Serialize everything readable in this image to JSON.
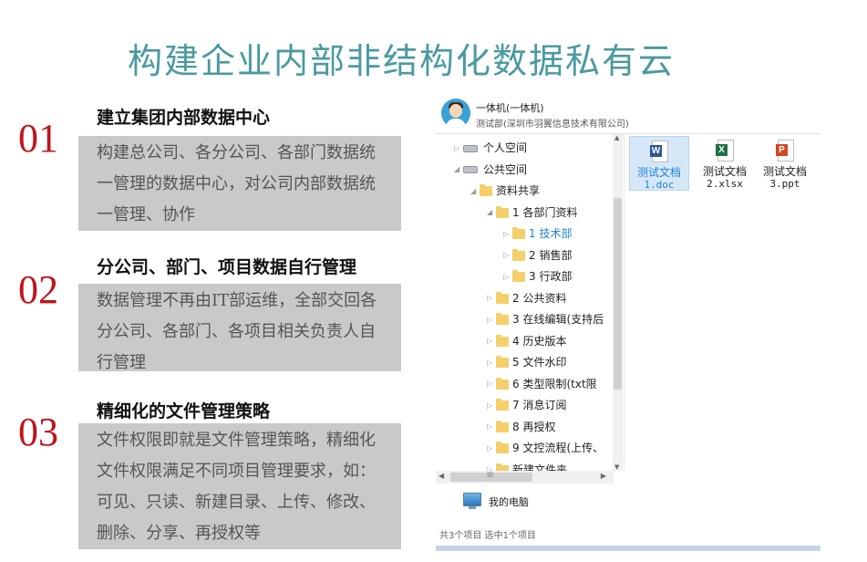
{
  "title": "构建企业内部非结构化数据私有云",
  "sections": [
    {
      "num": "01",
      "heading": "建立集团内部数据中心",
      "lines": [
        "构建总公司、各分公司、各部门数据统",
        "一管理的数据中心，对公司内部数据统",
        "一管理、协作"
      ]
    },
    {
      "num": "02",
      "heading": "分公司、部门、项目数据自行管理",
      "lines": [
        "数据管理不再由IT部运维，全部交回各",
        "分公司、各部门、各项目相关负责人自",
        "行管理"
      ]
    },
    {
      "num": "03",
      "heading": "精细化的文件管理策略",
      "lines": [
        "文件权限即就是文件管理策略，精细化",
        "文件权限满足不同项目管理要求，如：",
        "可见、只读、新建目录、上传、修改、",
        "删除、分享、再授权等"
      ]
    }
  ],
  "explorer": {
    "user_name": "一体机(一体机)",
    "user_org": "测试部(深圳市羽翼信息技术有限公司)",
    "tree": [
      {
        "label": "个人空间",
        "kind": "drive",
        "arrow": "▷"
      },
      {
        "label": "公共空间",
        "kind": "drive",
        "arrow": "◢"
      },
      {
        "label": "资料共享",
        "kind": "folder",
        "arrow": "◢"
      },
      {
        "label": "1 各部门资料",
        "kind": "folder",
        "arrow": "◢"
      },
      {
        "label": "1 技术部",
        "kind": "folder",
        "arrow": "▷",
        "selected": true
      },
      {
        "label": "2 销售部",
        "kind": "folder",
        "arrow": "▷"
      },
      {
        "label": "3 行政部",
        "kind": "folder",
        "arrow": "▷"
      },
      {
        "label": "2 公共资料",
        "kind": "folder",
        "arrow": "▷"
      },
      {
        "label": "3 在线编辑(支持后",
        "kind": "folder",
        "arrow": "▷"
      },
      {
        "label": "4 历史版本",
        "kind": "folder",
        "arrow": "▷"
      },
      {
        "label": "5 文件水印",
        "kind": "folder",
        "arrow": "▷"
      },
      {
        "label": "6 类型限制(txt限",
        "kind": "folder",
        "arrow": "▷"
      },
      {
        "label": "7 消息订阅",
        "kind": "folder",
        "arrow": "▷"
      },
      {
        "label": "8 再授权",
        "kind": "folder",
        "arrow": "▷"
      },
      {
        "label": "9 文控流程(上传、",
        "kind": "folder",
        "arrow": "▷"
      },
      {
        "label": "新建文件夹",
        "kind": "folder",
        "arrow": "▷"
      }
    ],
    "files": [
      {
        "name": "测试文档",
        "sub": "1.doc",
        "badge": "W",
        "color": "#2b5797"
      },
      {
        "name": "测试文档",
        "sub": "2.xlsx",
        "badge": "X",
        "color": "#1e7145"
      },
      {
        "name": "测试文档",
        "sub": "3.ppt",
        "badge": "P",
        "color": "#d24726"
      }
    ],
    "computer_label": "我的电脑",
    "status": "共3个项目  选中1个项目",
    "hscroll_mark": "III"
  }
}
